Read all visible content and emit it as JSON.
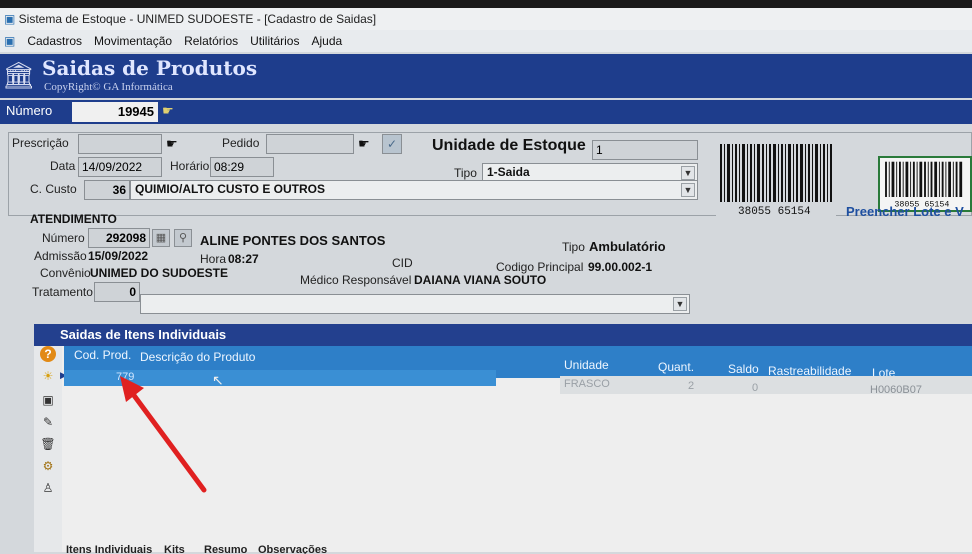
{
  "window": {
    "title": "Sistema de Estoque - UNIMED SUDOESTE - [Cadastro de Saidas]"
  },
  "menu": [
    "Cadastros",
    "Movimentação",
    "Relatórios",
    "Utilitários",
    "Ajuda"
  ],
  "banner": {
    "title": "Saidas de Produtos",
    "copyright": "CopyRight© GA Informática"
  },
  "numero": {
    "label": "Número",
    "value": "19945"
  },
  "header": {
    "prescricao_label": "Prescrição",
    "prescricao_value": "",
    "pedido_label": "Pedido",
    "pedido_value": "",
    "unidade_label": "Unidade de Estoque",
    "unidade_value": "1",
    "data_label": "Data",
    "data_value": "14/09/2022",
    "horario_label": "Horário",
    "horario_value": "08:29",
    "tipo_label": "Tipo",
    "tipo_value": "1-Saida",
    "ccusto_label": "C. Custo",
    "ccusto_code": "36",
    "ccusto_desc": "QUIMIO/ALTO CUSTO E OUTROS"
  },
  "barcode": {
    "text1": "38055 65154",
    "text2": "38055 65154",
    "caption": "Preencher Lote e V"
  },
  "atendimento": {
    "section_label": "ATENDIMENTO",
    "numero_label": "Número",
    "numero_value": "292098",
    "patient": "ALINE PONTES DOS SANTOS",
    "tipo_label": "Tipo",
    "tipo_value": "Ambulatório",
    "admissao_label": "Admissão",
    "admissao_value": "15/09/2022",
    "hora_label": "Hora",
    "hora_value": "08:27",
    "cid_label": "CID",
    "codigo_label": "Codigo Principal",
    "codigo_value": "99.00.002-1",
    "convenio_label": "Convênio",
    "convenio_value": "UNIMED DO SUDOESTE",
    "medico_label": "Médico Responsável",
    "medico_value": "DAIANA VIANA SOUTO",
    "tratamento_label": "Tratamento",
    "tratamento_value": "0"
  },
  "items": {
    "title": "Saidas de Itens Individuais",
    "columns": [
      "Cod. Prod.",
      "Descrição do Produto",
      "Unidade",
      "Quant.",
      "Saldo",
      "Rastreabilidade",
      "Lote"
    ],
    "rows": [
      {
        "cod": "779",
        "descricao": "",
        "unidade": "FRASCO",
        "quant": "2",
        "saldo": "0",
        "rastreabilidade": "",
        "lote": "H0060B07"
      }
    ]
  },
  "tabs": [
    "Itens Individuais",
    "Kits",
    "Resumo",
    "Observações"
  ],
  "colors": {
    "banner": "#1e3d8c",
    "grid_header": "#2e7fc8",
    "selected_row": "#3a8fd4",
    "annotation": "#e02020"
  }
}
